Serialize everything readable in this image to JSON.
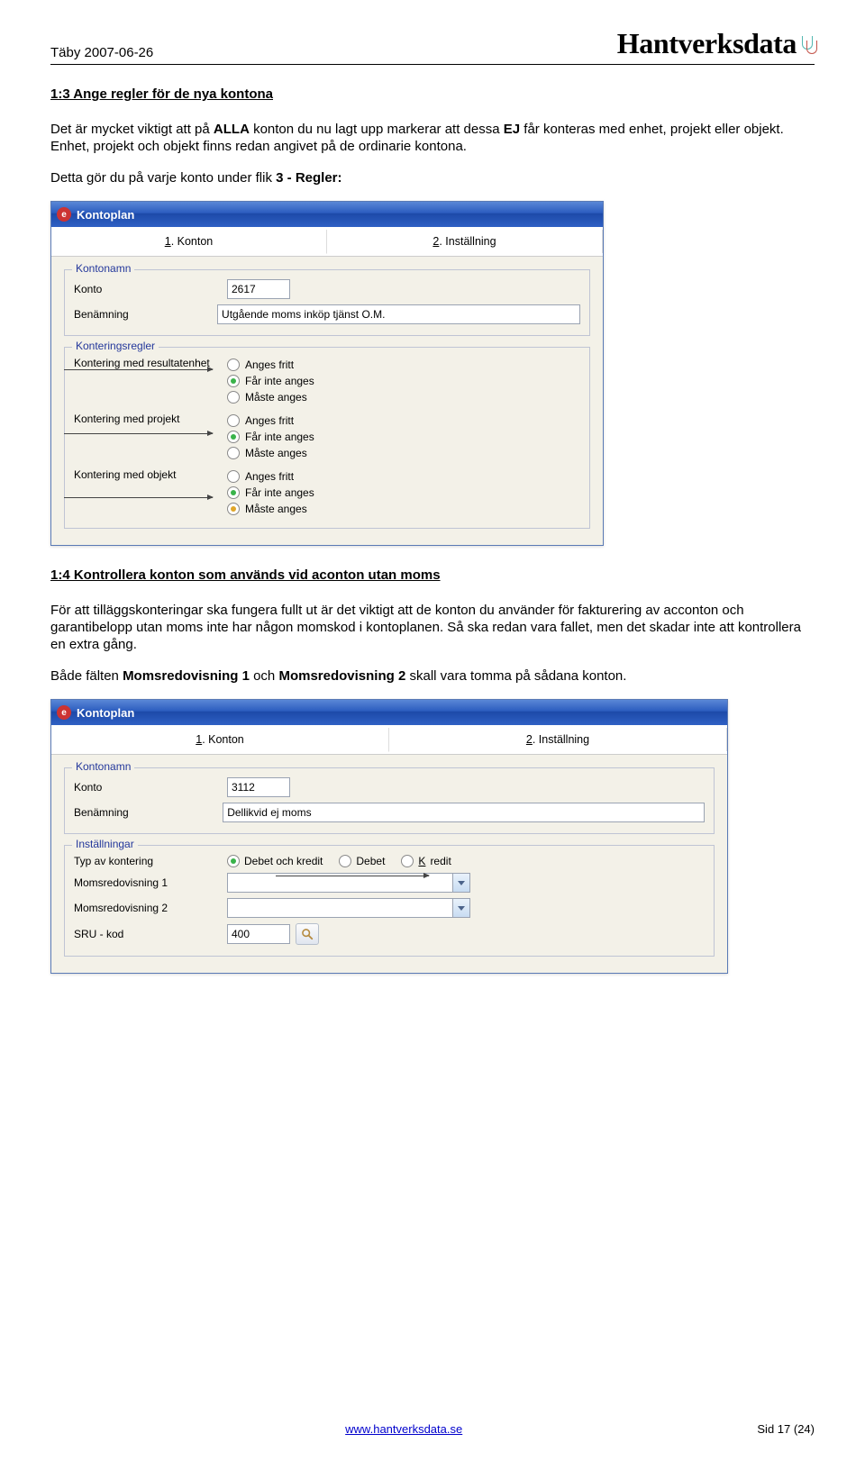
{
  "header": {
    "location_date": "Täby 2007-06-26",
    "brand": "Hantverksdata"
  },
  "section1": {
    "title": "1:3 Ange regler för de nya kontona",
    "p1_part1": "Det är mycket viktigt att på ",
    "p1_bold1": "ALLA",
    "p1_part2": " konton du nu lagt upp markerar att dessa ",
    "p1_bold2": "EJ",
    "p1_part3": " får konteras med enhet, projekt eller objekt. Enhet, projekt och objekt finns redan angivet på de ordinarie kontona.",
    "p2_part1": "Detta gör du på varje konto under flik ",
    "p2_bold1": "3 - Regler:"
  },
  "app1": {
    "title": "Kontoplan",
    "tabs": {
      "t1": "Konton",
      "t1_m": "1",
      "t2": "Inställning",
      "t2_m": "2"
    },
    "group1": {
      "title": "Kontonamn",
      "konto_label": "Konto",
      "konto_value": "2617",
      "benamning_label": "Benämning",
      "benamning_value": "Utgående moms inköp tjänst O.M."
    },
    "group2": {
      "title": "Konteringsregler",
      "rules": [
        {
          "label": "Kontering med resultatenhet",
          "options": [
            "Anges fritt",
            "Får inte anges",
            "Måste anges"
          ],
          "selected": 1,
          "yellow": false
        },
        {
          "label": "Kontering med projekt",
          "options": [
            "Anges fritt",
            "Får inte anges",
            "Måste anges"
          ],
          "selected": 1,
          "yellow": false
        },
        {
          "label": "Kontering med objekt",
          "options": [
            "Anges fritt",
            "Får inte anges",
            "Måste anges"
          ],
          "selected": 1,
          "yellow": true
        }
      ]
    }
  },
  "section2": {
    "title": "1:4 Kontrollera konton som används vid aconton utan moms",
    "p1": "För att tilläggskonteringar ska fungera fullt ut är det viktigt att de konton du använder för fakturering av acconton och garantibelopp utan moms inte har någon momskod i kontoplanen. Så ska redan vara fallet, men det skadar inte att kontrollera en extra gång.",
    "p2_part1": "Både fälten ",
    "p2_bold1": "Momsredovisning 1",
    "p2_mid": " och ",
    "p2_bold2": "Momsredovisning 2",
    "p2_part2": " skall vara tomma på sådana konton."
  },
  "app2": {
    "title": "Kontoplan",
    "tabs": {
      "t1": "Konton",
      "t1_m": "1",
      "t2": "Inställning",
      "t2_m": "2"
    },
    "group1": {
      "title": "Kontonamn",
      "konto_label": "Konto",
      "konto_value": "3112",
      "benamning_label": "Benämning",
      "benamning_value": "Dellikvid ej moms"
    },
    "group2": {
      "title": "Inställningar",
      "typ_label": "Typ av kontering",
      "typ_options": [
        "Debet och kredit",
        "Debet",
        "Kredit"
      ],
      "typ_selected": 0,
      "moms1_label": "Momsredovisning 1",
      "moms1_value": "",
      "moms2_label": "Momsredovisning 2",
      "moms2_value": "",
      "sru_label": "SRU - kod",
      "sru_value": "400"
    }
  },
  "footer": {
    "link": "www.hantverksdata.se",
    "page": "Sid 17 (24)"
  }
}
